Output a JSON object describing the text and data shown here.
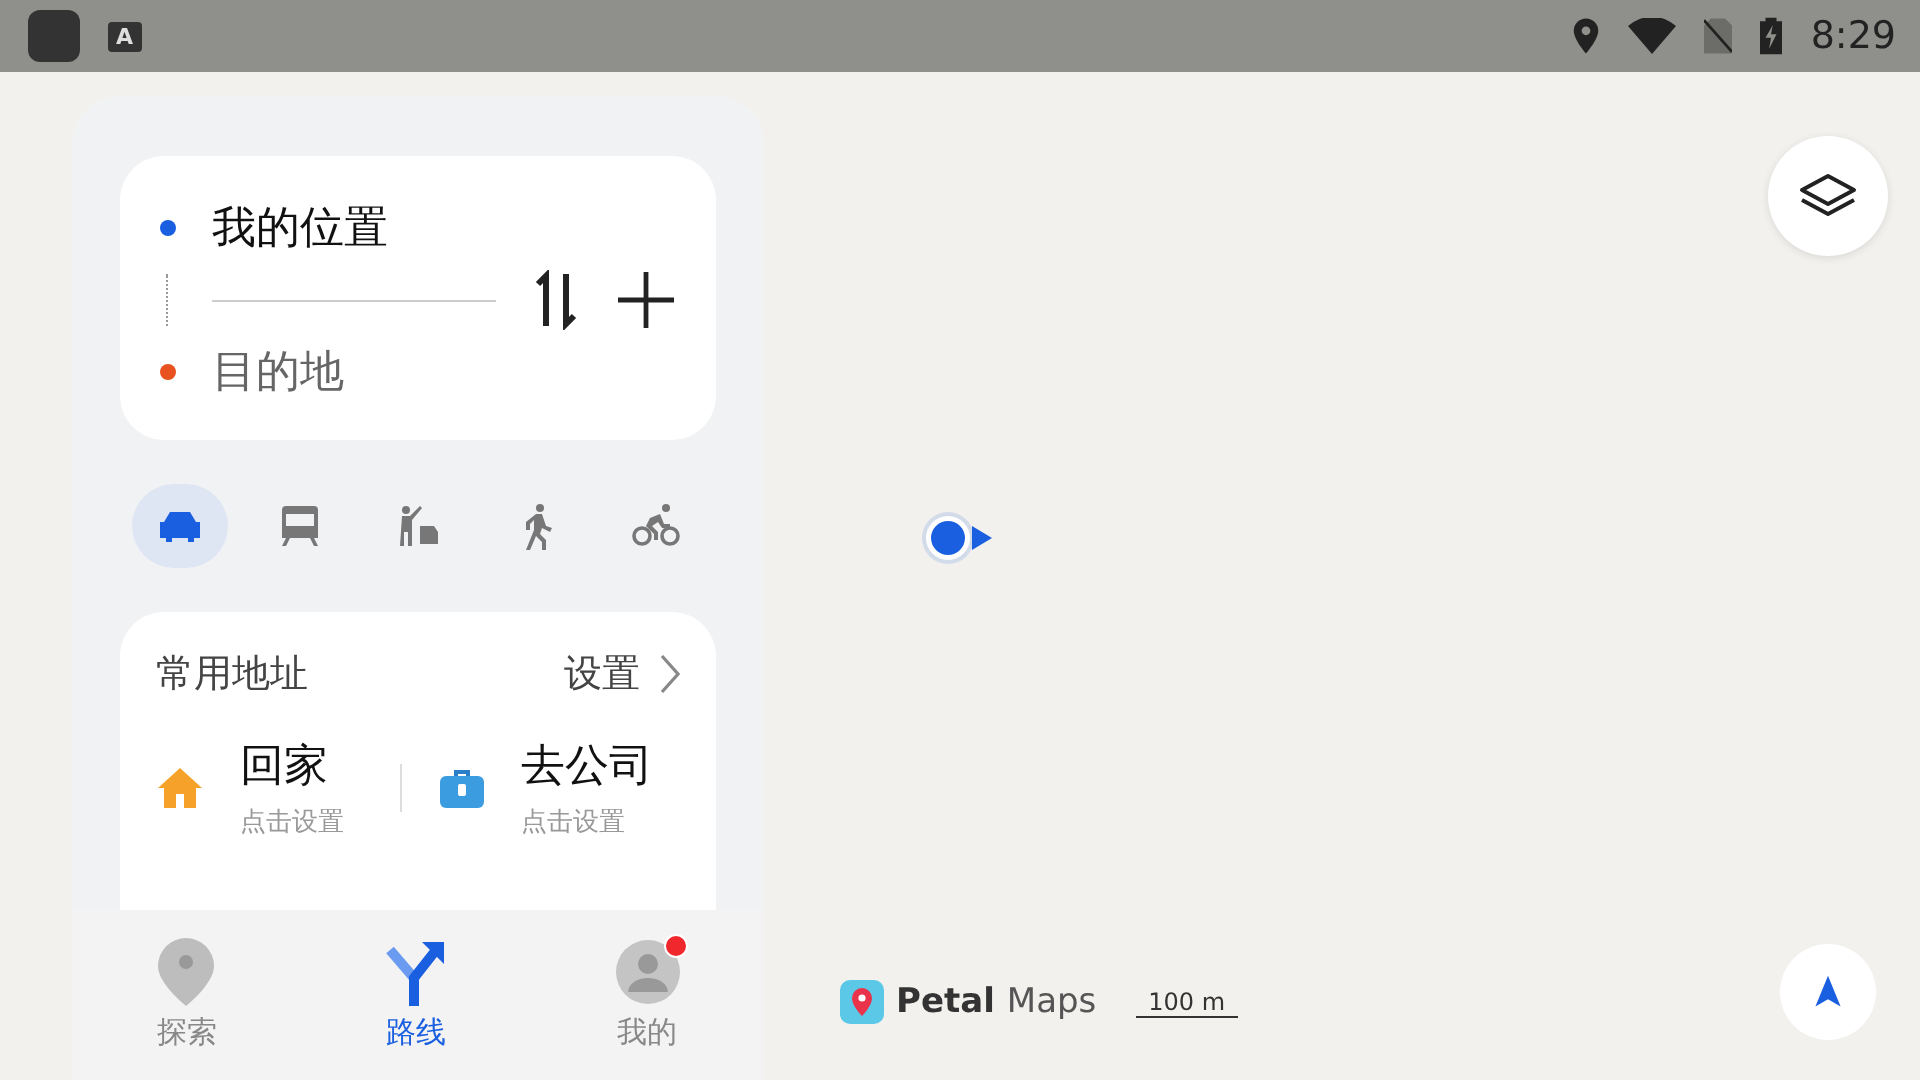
{
  "status_bar": {
    "time": "8:29",
    "app_icon_letter": "A"
  },
  "route_card": {
    "origin": "我的位置",
    "destination": "目的地"
  },
  "transport_modes": [
    {
      "kind": "car",
      "selected": true
    },
    {
      "kind": "bus",
      "selected": false
    },
    {
      "kind": "taxi",
      "selected": false
    },
    {
      "kind": "walk",
      "selected": false
    },
    {
      "kind": "bike",
      "selected": false
    }
  ],
  "common_addresses": {
    "title": "常用地址",
    "action": "设置",
    "items": [
      {
        "kind": "home",
        "title": "回家",
        "subtitle": "点击设置"
      },
      {
        "kind": "work",
        "title": "去公司",
        "subtitle": "点击设置"
      }
    ]
  },
  "bottom_nav": [
    {
      "kind": "explore",
      "label": "探索",
      "selected": false
    },
    {
      "kind": "route",
      "label": "路线",
      "selected": true
    },
    {
      "kind": "me",
      "label": "我的",
      "selected": false,
      "badge": true
    }
  ],
  "map": {
    "brand_bold": "Petal",
    "brand_light": "Maps",
    "scale": "100 m"
  }
}
